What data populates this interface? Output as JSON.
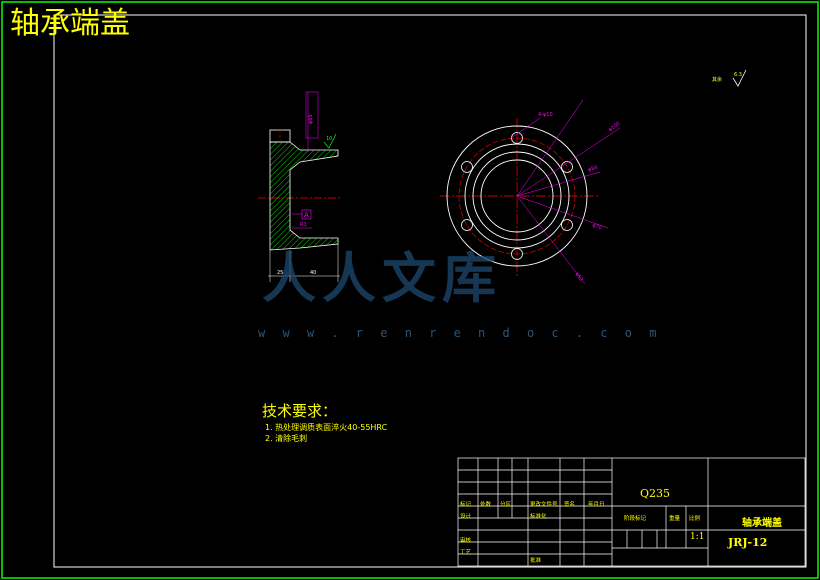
{
  "title": "轴承端盖",
  "tech": {
    "heading": "技术要求：",
    "items": [
      "1.    热处理调质表面淬火40-55HRC",
      "2.    清除毛刺"
    ]
  },
  "watermark": {
    "logo_text": "人人文库",
    "url": "w w w . r e n r e n d o c . c o m"
  },
  "title_block": {
    "material": "Q235",
    "part_name": "轴承端盖",
    "drawing_no": "JRJ-12",
    "scale": "1:1",
    "labels": {
      "mark": "标记",
      "count": "处数",
      "zone": "分区",
      "change_doc": "更改文件号",
      "sign": "签名",
      "date": "年月日",
      "design": "设计",
      "standardize": "标准化",
      "review": "审核",
      "process": "工艺",
      "approve": "批准",
      "stage_mark": "阶段标记",
      "weight": "重量",
      "scale_label": "比例"
    }
  },
  "annotations": {
    "roughness_other": "其余",
    "roughness_value": "6.3",
    "datum": "A",
    "dims": [
      "4-φ10",
      "φ100",
      "φ84",
      "φ70",
      "φ52",
      "φ65",
      "40",
      "25",
      "R1",
      "10"
    ]
  },
  "colors": {
    "frame": "#ffffff",
    "text": "#ffff00",
    "dimension": "#ff00ff",
    "centerline": "#ff0000",
    "section": "#00cc00",
    "border": "#00ff00"
  }
}
